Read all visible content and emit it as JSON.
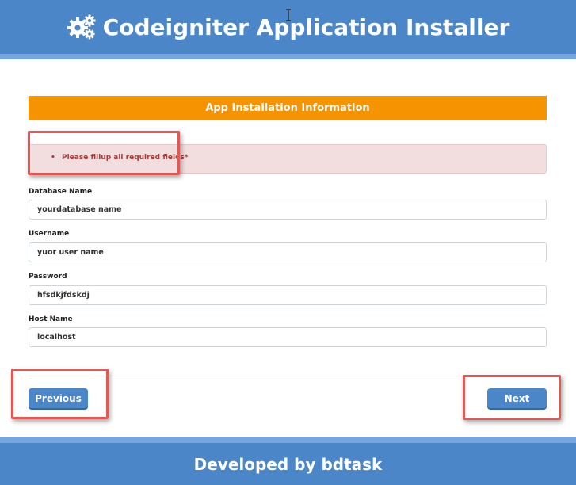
{
  "header": {
    "title": "Codeigniter Application Installer",
    "icon": "gears-icon",
    "color": "#4a86c8"
  },
  "section": {
    "title": "App Installation Information",
    "color": "#f59300"
  },
  "alert": {
    "message": "Please fillup all required fields*",
    "color": "#a33d3d"
  },
  "form": {
    "fields": [
      {
        "label": "Database Name",
        "value": "yourdatabase name"
      },
      {
        "label": "Username",
        "value": "yuor user name"
      },
      {
        "label": "Password",
        "value": "hfsdkjfdskdj"
      },
      {
        "label": "Host Name",
        "value": "localhost"
      }
    ]
  },
  "buttons": {
    "previous": "Previous",
    "next": "Next"
  },
  "footer": {
    "text": "Developed by bdtask"
  },
  "highlight_color": "#e05a55"
}
